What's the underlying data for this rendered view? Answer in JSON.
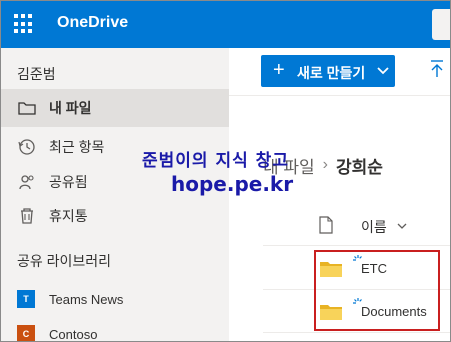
{
  "app": {
    "name": "OneDrive",
    "brand_color": "#0078d4"
  },
  "sidebar": {
    "user_name": "김준범",
    "items": [
      {
        "label": "내 파일",
        "icon": "folder-icon",
        "active": true
      },
      {
        "label": "최근 항목",
        "icon": "history-icon",
        "active": false
      },
      {
        "label": "공유됨",
        "icon": "people-icon",
        "active": false
      },
      {
        "label": "휴지통",
        "icon": "trash-icon",
        "active": false
      }
    ],
    "section_title": "공유 라이브러리",
    "libraries": [
      {
        "label": "Teams News",
        "badge": "T",
        "color": "#0078d4"
      },
      {
        "label": "Contoso",
        "badge": "C",
        "color": "#ca5010"
      }
    ]
  },
  "toolbar": {
    "new_label": "새로 만들기",
    "new_icon": "plus-icon",
    "upload_icon": "upload-icon"
  },
  "breadcrumb": {
    "parent": "내 파일",
    "current": "강희순"
  },
  "watermark": {
    "line1": "준범이의 지식 창고",
    "line2": "hope.pe.kr"
  },
  "list": {
    "column_name": "이름",
    "rows": [
      {
        "name": "ETC",
        "icon": "folder-icon"
      },
      {
        "name": "Documents",
        "icon": "folder-icon"
      }
    ]
  },
  "highlight_color": "#c91f1f"
}
